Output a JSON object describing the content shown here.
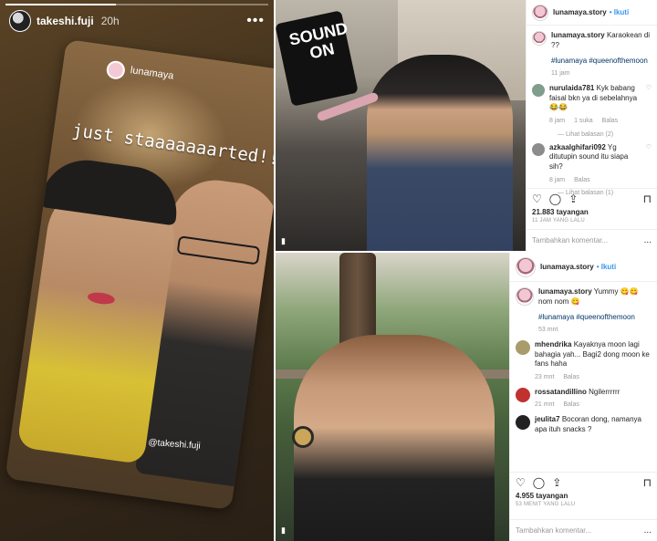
{
  "story": {
    "username": "takeshi.fuji",
    "time": "20h",
    "progress": 0.42,
    "card": {
      "mention": "lunamaya",
      "caption_line1": "just staaaaaaarted!!",
      "caption_line2": "",
      "tag": "@takeshi.fuji"
    }
  },
  "karaoke_photo": {
    "sign_text": "SOUND ON"
  },
  "post1": {
    "username": "lunamaya.story",
    "follow": "Ikuti",
    "caption_user": "lunamaya.story",
    "caption": "Karaokean di ??",
    "tags": "#lunamaya #queenofthemoon",
    "caption_time": "11 jam",
    "comments": [
      {
        "user": "nurulaida781",
        "text": "Kyk babang faisal bkn ya di sebelahnya 😂😂",
        "meta": [
          "8 jam",
          "1 suka",
          "Balas"
        ],
        "view_replies": "Lihat balasan (2)",
        "avatar_color": "#7f9e8e"
      },
      {
        "user": "azkaalghifari092",
        "text": "Yg ditutupin sound itu siapa sih?",
        "meta": [
          "8 jam",
          "Balas"
        ],
        "view_replies": "Lihat balasan (1)",
        "avatar_color": "#8c8c8c"
      }
    ],
    "views": "21.883 tayangan",
    "ago": "11 JAM YANG LALU",
    "add_comment": "Tambahkan komentar...",
    "more": "..."
  },
  "post2": {
    "username": "lunamaya.story",
    "follow": "Ikuti",
    "caption_user": "lunamaya.story",
    "caption": "Yummy 😋😋 nom nom 😋",
    "tags": "#lunamaya #queenofthemoon",
    "caption_time": "53 mnt",
    "comments": [
      {
        "user": "mhendrika",
        "text": "Kayaknya moon lagi bahagia yah... Bagi2 dong moon ke fans haha",
        "meta": [
          "23 mnt",
          "Balas"
        ],
        "avatar_color": "#a89c6a"
      },
      {
        "user": "rossatandillino",
        "text": "Ngilerrrrrr",
        "meta": [
          "21 mnt",
          "Balas"
        ],
        "avatar_color": "#c0312f"
      },
      {
        "user": "jeulita7",
        "text": "Bocoran dong, namanya apa ituh snacks ?",
        "meta": [],
        "avatar_color": "#222222"
      }
    ],
    "views": "4.955 tayangan",
    "ago": "53 MENIT YANG LALU",
    "add_comment": "Tambahkan komentar...",
    "more": "..."
  },
  "icons": [
    "heart-icon",
    "comment-icon",
    "share-icon",
    "bookmark-icon",
    "more-icon"
  ]
}
